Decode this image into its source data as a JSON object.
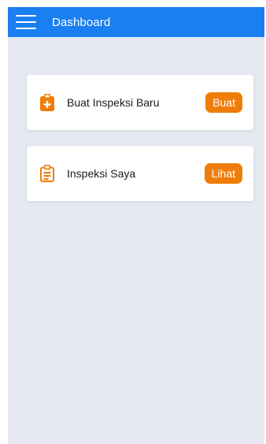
{
  "header": {
    "title": "Dashboard",
    "menu_icon": "hamburger-menu-icon",
    "background": "#1a7ff0"
  },
  "cards": [
    {
      "icon": "clipboard-plus-icon",
      "label": "Buat Inspeksi Baru",
      "button_label": "Buat"
    },
    {
      "icon": "clipboard-list-icon",
      "label": "Inspeksi Saya",
      "button_label": "Lihat"
    }
  ],
  "colors": {
    "accent": "#f07d0a",
    "page_bg": "#e5e8f1"
  }
}
